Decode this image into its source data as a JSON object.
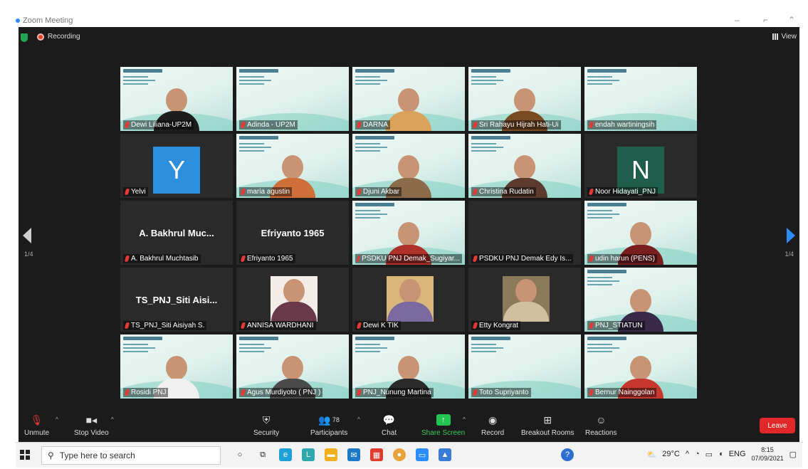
{
  "window": {
    "title": "Zoom Meeting"
  },
  "topbar": {
    "recording": "Recording",
    "view": "View"
  },
  "pager": {
    "left": "1/4",
    "right": "1/4"
  },
  "tiles": [
    {
      "name": "Dewi Liliana-UP2M",
      "kind": "video",
      "body": "#1d1d1d"
    },
    {
      "name": "Adinda - UP2M",
      "kind": "slide"
    },
    {
      "name": "DARNA",
      "kind": "video",
      "body": "#d9a35b"
    },
    {
      "name": "Sri Rahayu Hijrah Hati-Ui",
      "kind": "video",
      "body": "#7a4a22"
    },
    {
      "name": "endah wartiningsih",
      "kind": "slide"
    },
    {
      "name": "Yelvi",
      "kind": "avatar",
      "letter": "Y",
      "color": "#2b8fde"
    },
    {
      "name": "maria agustin",
      "kind": "video",
      "body": "#cf6f3a"
    },
    {
      "name": "Djuni Akbar",
      "kind": "video",
      "body": "#8b6b4a"
    },
    {
      "name": "Christina Rudatin",
      "kind": "video",
      "body": "#5a3b2e"
    },
    {
      "name": "Noor Hidayati_PNJ",
      "kind": "avatar",
      "letter": "N",
      "color": "#1f5e4a"
    },
    {
      "name": "A. Bakhrul Muchtasib",
      "kind": "text",
      "big": "A. Bakhrul Muc..."
    },
    {
      "name": "Efriyanto 1965",
      "kind": "text",
      "big": "Efriyanto 1965"
    },
    {
      "name": "PSDKU PNJ Demak_Sugiyar...",
      "kind": "video",
      "body": "#b0302a"
    },
    {
      "name": "PSDKU PNJ Demak Edy Is...",
      "kind": "blank"
    },
    {
      "name": "udin harun (PENS)",
      "kind": "video",
      "body": "#7a1f1f"
    },
    {
      "name": "TS_PNJ_Siti Aisiyah S.",
      "kind": "text",
      "big": "TS_PNJ_Siti Aisi..."
    },
    {
      "name": "ANNISA WARDHANI",
      "kind": "photo"
    },
    {
      "name": "Dewi K TIK",
      "kind": "photo2"
    },
    {
      "name": "Etty Kongrat",
      "kind": "photo3"
    },
    {
      "name": "PNJ_STIATUN",
      "kind": "video",
      "body": "#3a2a4a"
    },
    {
      "name": "Rosidi PNJ",
      "kind": "video",
      "body": "#f0f0f0"
    },
    {
      "name": "Agus Murdiyoto ( PNJ )",
      "kind": "video",
      "body": "#4a4a4a"
    },
    {
      "name": "PNJ_Nunung Martina",
      "kind": "video",
      "body": "#2a2a2a"
    },
    {
      "name": "Toto Supriyanto",
      "kind": "slide"
    },
    {
      "name": "Bernur Nainggolan",
      "kind": "video",
      "body": "#c8372e"
    }
  ],
  "toolbar": {
    "unmute": "Unmute",
    "stop_video": "Stop Video",
    "security": "Security",
    "participants": "Participants",
    "participant_count": "78",
    "chat": "Chat",
    "share_screen": "Share Screen",
    "record": "Record",
    "breakout": "Breakout Rooms",
    "reactions": "Reactions",
    "leave": "Leave"
  },
  "taskbar": {
    "search_placeholder": "Type here to search",
    "temp": "29°C",
    "lang": "ENG",
    "time": "8:15",
    "date": "07/09/2021"
  },
  "colors": {
    "stage": "#1b1b1b",
    "accent": "#2d8cff",
    "share": "#23c552",
    "leave": "#e02828",
    "mic_off": "#e53935"
  }
}
